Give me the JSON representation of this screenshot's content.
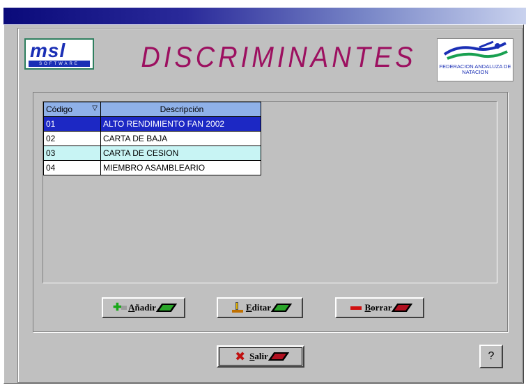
{
  "title": "DISCRIMINANTES",
  "logos": {
    "msl_letters": "msl",
    "msl_sub": "SOFTWARE",
    "fan_text": "FEDERACION ANDALUZA DE NATACION"
  },
  "table": {
    "headers": [
      "Código",
      "Descripción"
    ],
    "rows": [
      {
        "codigo": "01",
        "descripcion": "ALTO RENDIMIENTO FAN 2002",
        "state": "selected"
      },
      {
        "codigo": "02",
        "descripcion": "CARTA DE BAJA",
        "state": "normal"
      },
      {
        "codigo": "03",
        "descripcion": "CARTA DE CESION",
        "state": "alt"
      },
      {
        "codigo": "04",
        "descripcion": "MIEMBRO ASAMBLEARIO",
        "state": "normal"
      }
    ]
  },
  "buttons": {
    "add": {
      "prefix": "A",
      "rest": "ñadir"
    },
    "edit": {
      "prefix": "E",
      "rest": "ditar"
    },
    "delete": {
      "prefix": "B",
      "rest": "orrar"
    },
    "exit": {
      "prefix": "S",
      "rest": "alir"
    },
    "help": "?"
  },
  "colors": {
    "title": "#9c1060",
    "selected_row": "#1c28c4",
    "alt_row": "#c8f4f4",
    "header": "#8fb1e8"
  }
}
